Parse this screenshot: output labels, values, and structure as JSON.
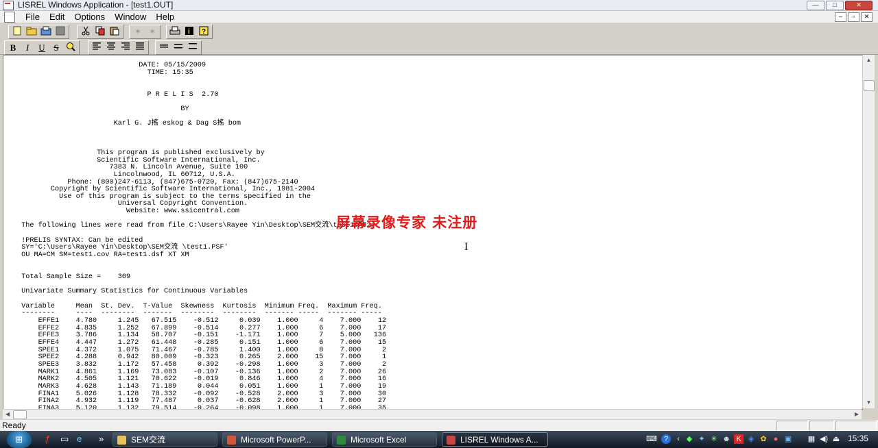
{
  "window": {
    "title": "LISREL Windows Application - [test1.OUT]",
    "buttons": [
      "—",
      "□",
      "✕"
    ]
  },
  "menu": {
    "items": [
      "File",
      "Edit",
      "Options",
      "Window",
      "Help"
    ],
    "mdi_buttons": [
      "–",
      "▫",
      "✕"
    ]
  },
  "toolbar1": {
    "icons": [
      "new-file-icon",
      "open-folder-icon",
      "open-file-icon",
      "save-icon",
      "cut-icon",
      "copy-icon",
      "paste-icon",
      "path-diagram-icon",
      "path-diagram-2-icon",
      "print-icon",
      "info-icon",
      "help-icon"
    ]
  },
  "toolbar2": {
    "bold": "B",
    "italic": "I",
    "underline": "U",
    "strike": "S",
    "icons": [
      "bold-icon",
      "italic-icon",
      "underline-icon",
      "strikethrough-icon",
      "font-icon",
      "align-left-icon",
      "align-center-icon",
      "align-right-icon",
      "justify-icon",
      "single-spacing-icon",
      "one-half-spacing-icon",
      "double-spacing-icon"
    ]
  },
  "document": {
    "header": "                             DATE: 05/15/2009\n                               TIME: 15:35\n\n\n                               P R E L I S  2.70\n\n                                       BY\n\n                       Karl G. J搖 eskog & Dag S搖 bom\n\n\n\n                   This program is published exclusively by\n                   Scientific Software International, Inc.\n                      7383 N. Lincoln Avenue, Suite 100\n                       Lincolnwood, IL 60712, U.S.A.\n            Phone: (800)247-6113, (847)675-0720, Fax: (847)675-2140\n        Copyright by Scientific Software International, Inc., 1981-2004\n          Use of this program is subject to the terms specified in the\n                        Universal Copyright Convention.\n                          Website: www.ssicentral.com\n\n The following lines were read from file C:\\Users\\Rayee Yin\\Desktop\\SEM交流\\test1.PR2:\n\n !PRELIS SYNTAX: Can be edited\n SY='C:\\Users\\Rayee Yin\\Desktop\\SEM交流 \\test1.PSF'\n OU MA=CM SM=test1.cov RA=test1.dsf XT XM\n\n\n Total Sample Size =    309\n\n Univariate Summary Statistics for Continuous Variables\n\n Variable     Mean  St. Dev.  T-Value  Skewness  Kurtosis  Minimum Freq.  Maximum Freq.\n --------     ----  --------  -------  --------  --------  ------- -----  ------- -----",
    "rows": [
      [
        "EFFE1",
        "4.780",
        "1.245",
        "67.515",
        "-0.512",
        "0.039",
        "1.000",
        "4",
        "7.000",
        "12"
      ],
      [
        "EFFE2",
        "4.835",
        "1.252",
        "67.899",
        "-0.514",
        "0.277",
        "1.000",
        "6",
        "7.000",
        "17"
      ],
      [
        "EFFE3",
        "3.786",
        "1.134",
        "58.707",
        "-0.151",
        "-1.171",
        "1.000",
        "7",
        "5.000",
        "136"
      ],
      [
        "EFFE4",
        "4.447",
        "1.272",
        "61.448",
        "-0.285",
        "0.151",
        "1.000",
        "6",
        "7.000",
        "15"
      ],
      [
        "SPEE1",
        "4.372",
        "1.075",
        "71.467",
        "-0.785",
        "1.400",
        "1.000",
        "8",
        "7.000",
        "2"
      ],
      [
        "SPEE2",
        "4.288",
        "0.942",
        "80.009",
        "-0.323",
        "0.265",
        "2.000",
        "15",
        "7.000",
        "1"
      ],
      [
        "SPEE3",
        "3.832",
        "1.172",
        "57.458",
        "0.392",
        "-0.298",
        "1.000",
        "3",
        "7.000",
        "2"
      ],
      [
        "MARK1",
        "4.861",
        "1.169",
        "73.083",
        "-0.107",
        "-0.136",
        "1.000",
        "2",
        "7.000",
        "26"
      ],
      [
        "MARK2",
        "4.505",
        "1.121",
        "70.622",
        "-0.019",
        "0.846",
        "1.000",
        "4",
        "7.000",
        "16"
      ],
      [
        "MARK3",
        "4.628",
        "1.143",
        "71.189",
        "0.044",
        "0.051",
        "1.000",
        "1",
        "7.000",
        "19"
      ],
      [
        "FINA1",
        "5.026",
        "1.128",
        "78.332",
        "-0.092",
        "-0.528",
        "2.000",
        "3",
        "7.000",
        "30"
      ],
      [
        "FINA2",
        "4.932",
        "1.119",
        "77.487",
        "0.037",
        "-0.628",
        "2.000",
        "1",
        "7.000",
        "27"
      ],
      [
        "FINA3",
        "5.120",
        "1.132",
        "79.514",
        "-0.264",
        "-0.098",
        "1.000",
        "1",
        "7.000",
        "35"
      ]
    ]
  },
  "watermark": "屏幕录像专家  未注册",
  "status": {
    "text": "Ready"
  },
  "taskbar": {
    "start_icon": "windows-logo-icon",
    "quicklaunch": [
      "flash-icon",
      "desktop-icon",
      "ie-icon"
    ],
    "more": "»",
    "tasks": [
      {
        "label": "SEM交流",
        "icon": "folder-icon",
        "color": "#e8c25a",
        "active": false
      },
      {
        "label": "Microsoft PowerP...",
        "icon": "powerpoint-icon",
        "color": "#d2573a",
        "active": false
      },
      {
        "label": "Microsoft Excel",
        "icon": "excel-icon",
        "color": "#2f8a3e",
        "active": false
      },
      {
        "label": "LISREL Windows A...",
        "icon": "lisrel-icon",
        "color": "#c44",
        "active": true
      }
    ],
    "clock": "15:35",
    "tray_icons": [
      "keyboard-icon",
      "help-icon",
      "collapse-icon",
      "network-tray-icon",
      "tray-app-1-icon",
      "tray-app-2-icon",
      "user-icon",
      "tray-app-3-icon",
      "tray-app-4-icon",
      "tray-app-5-icon",
      "tray-app-6-icon",
      "tray-app-7-icon",
      "network-icon",
      "volume-icon",
      "safely-remove-icon"
    ]
  }
}
